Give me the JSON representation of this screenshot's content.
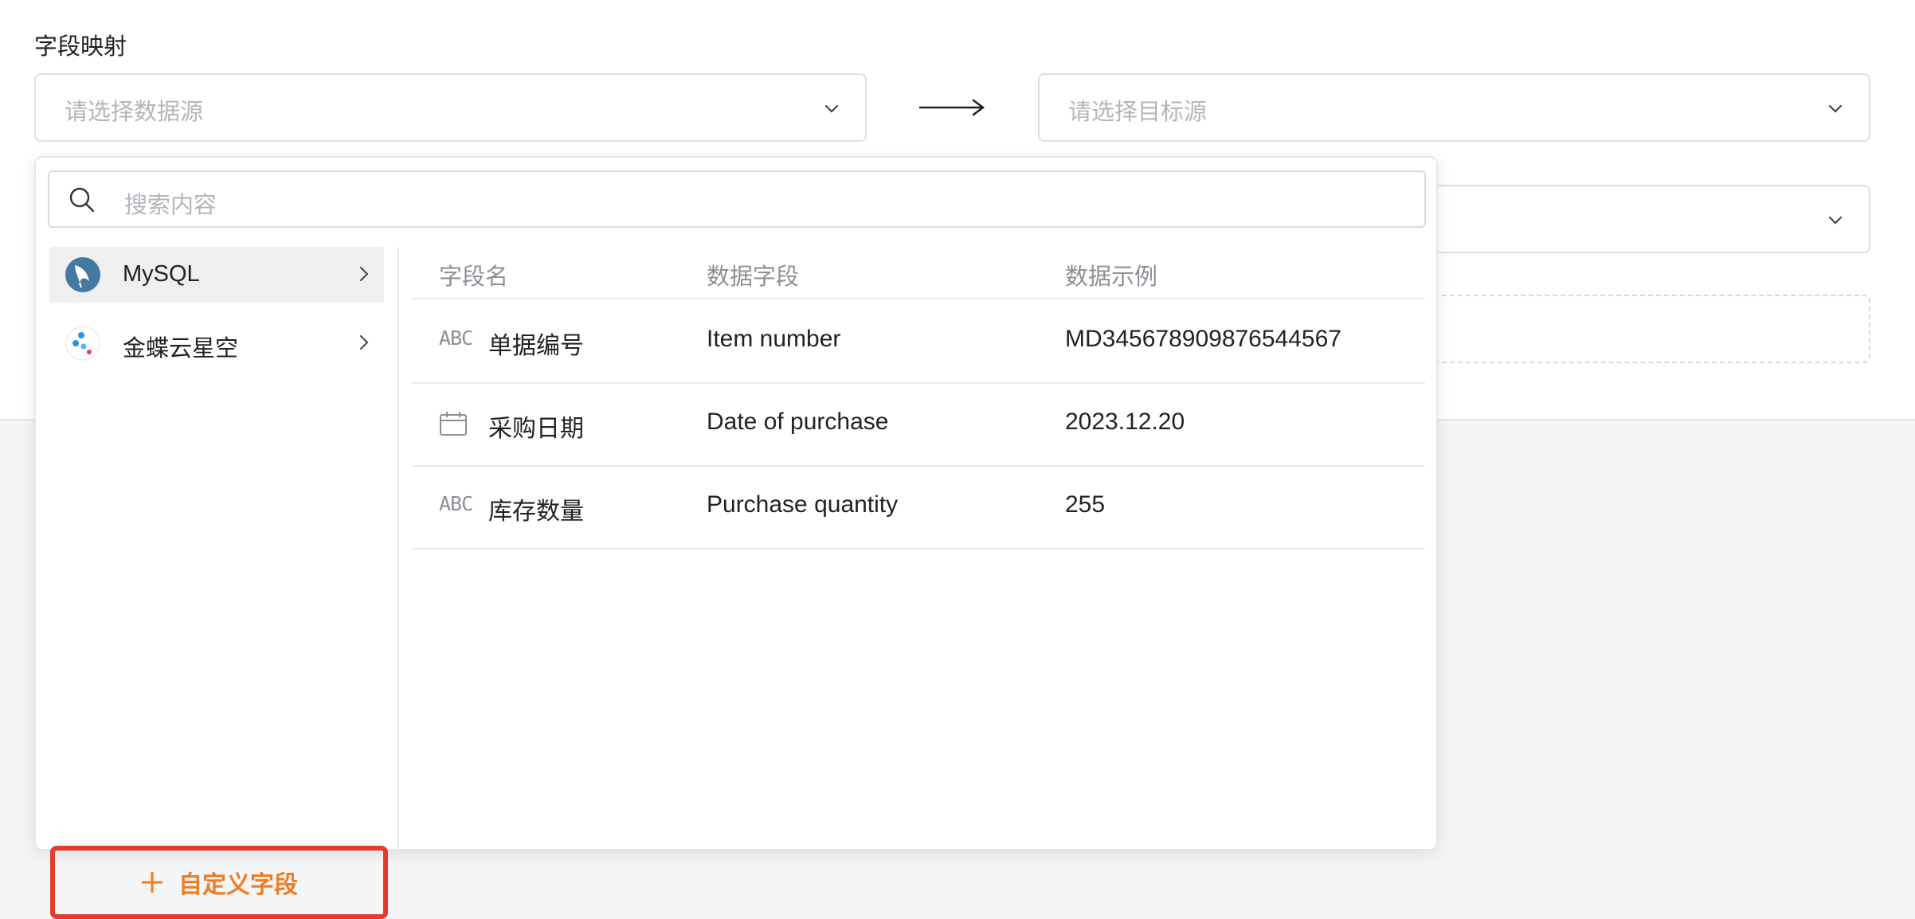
{
  "section": {
    "title": "字段映射"
  },
  "source_select": {
    "placeholder": "请选择数据源"
  },
  "target_select": {
    "placeholder": "请选择目标源"
  },
  "dropdown": {
    "search_placeholder": "搜索内容",
    "sources": [
      {
        "label": "MySQL",
        "icon": "mysql-dolphin-icon",
        "active": true
      },
      {
        "label": "金蝶云星空",
        "icon": "kingdee-icon",
        "active": false
      }
    ],
    "add_field_label": "自定义字段",
    "columns": [
      "字段名",
      "数据字段",
      "数据示例"
    ],
    "rows": [
      {
        "type": "ABC",
        "type_icon": "text-type-icon",
        "name": "单据编号",
        "field": "Item number",
        "sample": "MD345678909876544567"
      },
      {
        "type": "",
        "type_icon": "calendar-icon",
        "name": "采购日期",
        "field": "Date of purchase",
        "sample": "2023.12.20"
      },
      {
        "type": "ABC",
        "type_icon": "text-type-icon",
        "name": "库存数量",
        "field": "Purchase quantity",
        "sample": "255"
      }
    ]
  },
  "colors": {
    "accent": "#ef7d22",
    "highlight_border": "#e53b2c",
    "mysql": "#4479a1"
  }
}
